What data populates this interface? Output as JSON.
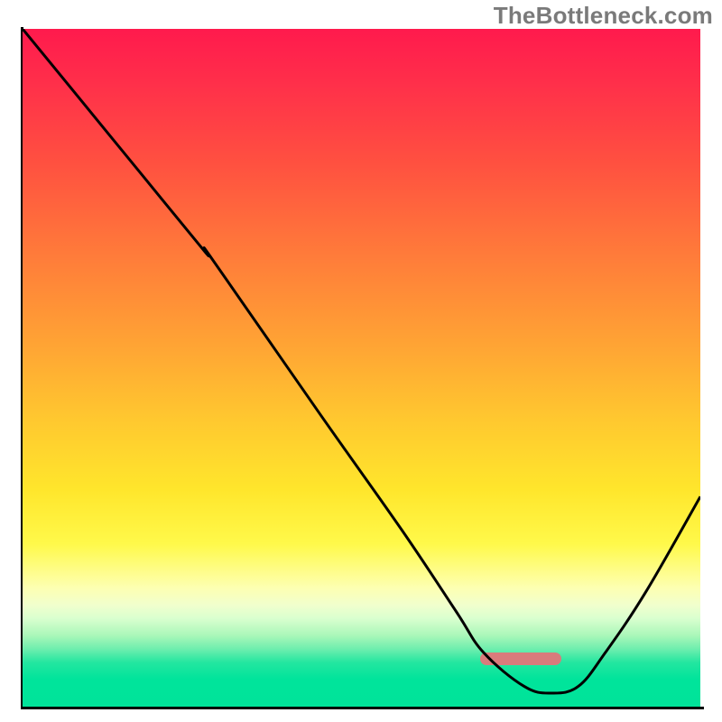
{
  "watermark": "TheBottleneck.com",
  "colors": {
    "gradient_top": "#ff1a4d",
    "gradient_mid": "#ffe62c",
    "gradient_bottom": "#00e39a",
    "curve": "#000000",
    "marker": "#d97b7c",
    "axis": "#000000"
  },
  "marker": {
    "x_start_pct": 67.5,
    "x_end_pct": 79.5,
    "y_pct": 93.0
  },
  "chart_data": {
    "type": "line",
    "title": "",
    "xlabel": "",
    "ylabel": "",
    "xlim": [
      0,
      100
    ],
    "ylim": [
      0,
      100
    ],
    "grid": false,
    "legend": false,
    "x": [
      0,
      9,
      18,
      27,
      28,
      44,
      56,
      64,
      68,
      74,
      78,
      82,
      86,
      92,
      100
    ],
    "values": [
      100,
      89,
      78,
      67,
      66,
      43,
      26,
      14,
      8,
      3,
      2,
      3,
      8,
      17,
      31
    ],
    "optimal_range_x": [
      67.5,
      79.5
    ],
    "optimal_value": 7,
    "note": "y-values are approximate percentage heights read from an unlabeled chart; higher = more bottleneck (red), lower = optimal (green)."
  }
}
